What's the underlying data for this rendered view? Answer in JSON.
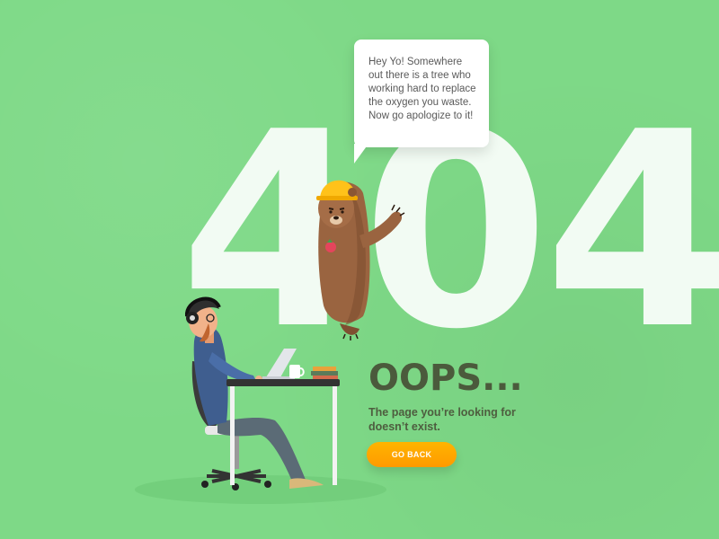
{
  "error_code": "404",
  "speech_bubble": {
    "text": "Hey Yo! Somewhere out there is a tree who working hard to replace the oxygen you waste. Now go apologize to it!"
  },
  "headline": "OOPS...",
  "message": "The page you’re looking for doesn’t exist.",
  "actions": {
    "go_back_label": "GO BACK"
  },
  "colors": {
    "background": "#7ed987",
    "digits": "#f2fbf3",
    "headline": "#4b5a3c",
    "button": "#ffa800",
    "bear_fur": "#9a6440",
    "helmet": "#ffc21a"
  },
  "illustration": {
    "characters": [
      "bear-with-hard-hat",
      "man-working-at-desk"
    ]
  }
}
